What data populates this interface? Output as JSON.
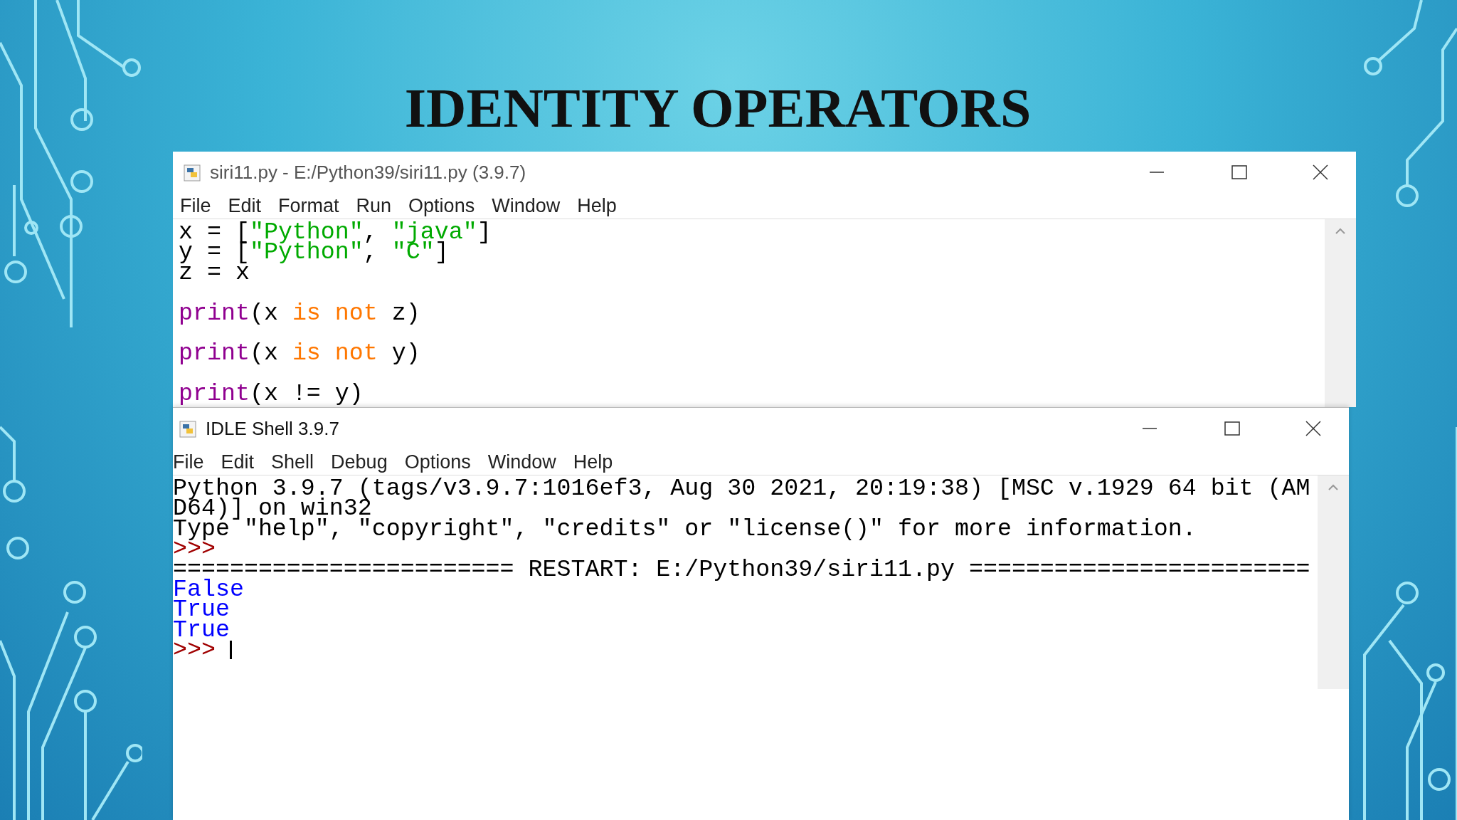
{
  "slide": {
    "title": "IDENTITY OPERATORS"
  },
  "editor": {
    "title": "siri11.py - E:/Python39/siri11.py (3.9.7)",
    "menu": [
      "File",
      "Edit",
      "Format",
      "Run",
      "Options",
      "Window",
      "Help"
    ],
    "lines": [
      {
        "gap_before": false,
        "tokens": [
          {
            "kind": "plain",
            "text": "x = ["
          },
          {
            "kind": "string",
            "text": "\"Python\""
          },
          {
            "kind": "plain",
            "text": ", "
          },
          {
            "kind": "string",
            "text": "\"java\""
          },
          {
            "kind": "plain",
            "text": "]"
          }
        ]
      },
      {
        "gap_before": false,
        "tokens": [
          {
            "kind": "plain",
            "text": "y = ["
          },
          {
            "kind": "string",
            "text": "\"Python\""
          },
          {
            "kind": "plain",
            "text": ", "
          },
          {
            "kind": "string",
            "text": "\"C\""
          },
          {
            "kind": "plain",
            "text": "]"
          }
        ]
      },
      {
        "gap_before": false,
        "tokens": [
          {
            "kind": "plain",
            "text": "z = x"
          }
        ]
      },
      {
        "gap_before": true,
        "tokens": [
          {
            "kind": "builtin",
            "text": "print"
          },
          {
            "kind": "plain",
            "text": "(x "
          },
          {
            "kind": "keyword",
            "text": "is not"
          },
          {
            "kind": "plain",
            "text": " z)"
          }
        ]
      },
      {
        "gap_before": true,
        "tokens": [
          {
            "kind": "builtin",
            "text": "print"
          },
          {
            "kind": "plain",
            "text": "(x "
          },
          {
            "kind": "keyword",
            "text": "is not"
          },
          {
            "kind": "plain",
            "text": " y)"
          }
        ]
      },
      {
        "gap_before": true,
        "tokens": [
          {
            "kind": "builtin",
            "text": "print"
          },
          {
            "kind": "plain",
            "text": "(x != y)"
          }
        ]
      }
    ]
  },
  "shell": {
    "title": "IDLE Shell 3.9.7",
    "menu": [
      "File",
      "Edit",
      "Shell",
      "Debug",
      "Options",
      "Window",
      "Help"
    ],
    "lines": [
      {
        "kind": "plain",
        "text": "Python 3.9.7 (tags/v3.9.7:1016ef3, Aug 30 2021, 20:19:38) [MSC v.1929 64 bit (AM"
      },
      {
        "kind": "plain",
        "text": "D64)] on win32"
      },
      {
        "kind": "plain",
        "text": "Type \"help\", \"copyright\", \"credits\" or \"license()\" for more information."
      },
      {
        "kind": "prompt",
        "text": ">>>"
      },
      {
        "kind": "plain",
        "text": "======================== RESTART: E:/Python39/siri11.py ========================"
      },
      {
        "kind": "output",
        "text": "False"
      },
      {
        "kind": "output",
        "text": "True"
      },
      {
        "kind": "output",
        "text": "True"
      },
      {
        "kind": "prompt",
        "text": ">>> ",
        "cursor": true
      }
    ]
  }
}
